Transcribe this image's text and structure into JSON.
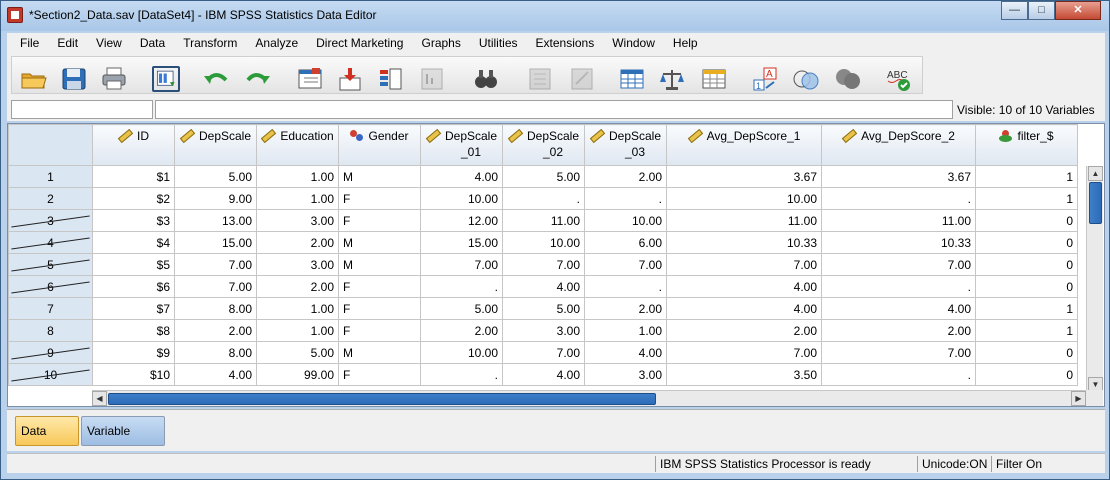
{
  "window": {
    "title": "*Section2_Data.sav [DataSet4] - IBM SPSS Statistics Data Editor",
    "minimize_label": "—",
    "maximize_label": "□",
    "close_label": "✕"
  },
  "menu": [
    "File",
    "Edit",
    "View",
    "Data",
    "Transform",
    "Analyze",
    "Direct Marketing",
    "Graphs",
    "Utilities",
    "Extensions",
    "Window",
    "Help"
  ],
  "toolbar": {
    "icons": [
      "open-folder-icon",
      "save-icon",
      "print-icon",
      "dialog-recall-icon",
      "undo-icon",
      "redo-icon",
      "go-to-case-icon",
      "go-to-variable-icon",
      "variables-icon",
      "run-descriptives-icon",
      "find-icon",
      "insert-cases-icon",
      "insert-variable-icon",
      "split-file-icon",
      "weight-cases-icon",
      "select-cases-icon",
      "value-labels-icon",
      "use-variable-sets-icon",
      "show-all-variables-icon",
      "spell-check-icon"
    ]
  },
  "cell_editor": {
    "name_value": "",
    "value": "",
    "visible_label": "Visible: 10 of 10 Variables"
  },
  "grid": {
    "columns": [
      {
        "label1": "ID",
        "label2": "",
        "icon": "scale",
        "align": "num"
      },
      {
        "label1": "DepScale",
        "label2": "",
        "icon": "scale",
        "align": "num"
      },
      {
        "label1": "Education",
        "label2": "",
        "icon": "scale",
        "align": "num"
      },
      {
        "label1": "Gender",
        "label2": "",
        "icon": "nominal",
        "align": "str"
      },
      {
        "label1": "DepScale",
        "label2": "_01",
        "icon": "scale",
        "align": "num"
      },
      {
        "label1": "DepScale",
        "label2": "_02",
        "icon": "scale",
        "align": "num"
      },
      {
        "label1": "DepScale",
        "label2": "_03",
        "icon": "scale",
        "align": "num"
      },
      {
        "label1": "Avg_DepScore_1",
        "label2": "",
        "icon": "scale",
        "align": "num"
      },
      {
        "label1": "Avg_DepScore_2",
        "label2": "",
        "icon": "scale",
        "align": "num"
      },
      {
        "label1": "filter_$",
        "label2": "",
        "icon": "filter",
        "align": "num"
      }
    ],
    "rows": [
      {
        "num": "1",
        "filtered": false,
        "cells": [
          "$1",
          "5.00",
          "1.00",
          "M",
          "4.00",
          "5.00",
          "2.00",
          "3.67",
          "3.67",
          "1"
        ]
      },
      {
        "num": "2",
        "filtered": false,
        "cells": [
          "$2",
          "9.00",
          "1.00",
          "F",
          "10.00",
          ".",
          ".",
          "10.00",
          ".",
          "1"
        ]
      },
      {
        "num": "3",
        "filtered": true,
        "cells": [
          "$3",
          "13.00",
          "3.00",
          "F",
          "12.00",
          "11.00",
          "10.00",
          "11.00",
          "11.00",
          "0"
        ]
      },
      {
        "num": "4",
        "filtered": true,
        "cells": [
          "$4",
          "15.00",
          "2.00",
          "M",
          "15.00",
          "10.00",
          "6.00",
          "10.33",
          "10.33",
          "0"
        ]
      },
      {
        "num": "5",
        "filtered": true,
        "cells": [
          "$5",
          "7.00",
          "3.00",
          "M",
          "7.00",
          "7.00",
          "7.00",
          "7.00",
          "7.00",
          "0"
        ]
      },
      {
        "num": "6",
        "filtered": true,
        "cells": [
          "$6",
          "7.00",
          "2.00",
          "F",
          ".",
          "4.00",
          ".",
          "4.00",
          ".",
          "0"
        ]
      },
      {
        "num": "7",
        "filtered": false,
        "cells": [
          "$7",
          "8.00",
          "1.00",
          "F",
          "5.00",
          "5.00",
          "2.00",
          "4.00",
          "4.00",
          "1"
        ]
      },
      {
        "num": "8",
        "filtered": false,
        "cells": [
          "$8",
          "2.00",
          "1.00",
          "F",
          "2.00",
          "3.00",
          "1.00",
          "2.00",
          "2.00",
          "1"
        ]
      },
      {
        "num": "9",
        "filtered": true,
        "cells": [
          "$9",
          "8.00",
          "5.00",
          "M",
          "10.00",
          "7.00",
          "4.00",
          "7.00",
          "7.00",
          "0"
        ]
      },
      {
        "num": "10",
        "filtered": true,
        "cells": [
          "$10",
          "4.00",
          "99.00",
          "F",
          ".",
          "4.00",
          "3.00",
          "3.50",
          ".",
          "0"
        ]
      }
    ]
  },
  "tabs": {
    "data_view": "Data View",
    "variable_view": "Variable View",
    "active": "data_view"
  },
  "status": {
    "processor": "IBM SPSS Statistics Processor is ready",
    "unicode": "Unicode:ON",
    "filter": "Filter On"
  }
}
